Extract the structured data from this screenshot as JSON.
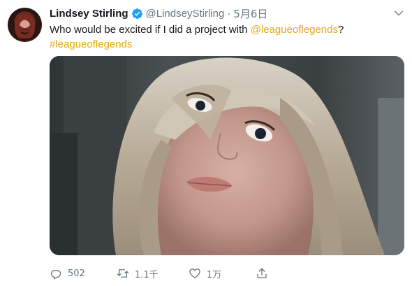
{
  "tweet": {
    "author_name": "Lindsey Stirling",
    "handle": "@LindseyStirling",
    "separator": "·",
    "date": "5月6日",
    "text_before": "Who would be excited if I did a project with ",
    "mention": "@leagueoflegends",
    "text_after": "?",
    "hashtag": "#leagueoflegends"
  },
  "actions": {
    "reply_count": "502",
    "retweet_count": "1.1千",
    "like_count": "1万"
  },
  "icons": {
    "verified": "verified-badge-icon",
    "caret": "chevron-down-icon",
    "reply": "reply-icon",
    "retweet": "retweet-icon",
    "like": "heart-icon",
    "share": "share-icon"
  },
  "colors": {
    "link": "#e0a814",
    "verified": "#1da1f2",
    "secondary_text": "#657786"
  }
}
